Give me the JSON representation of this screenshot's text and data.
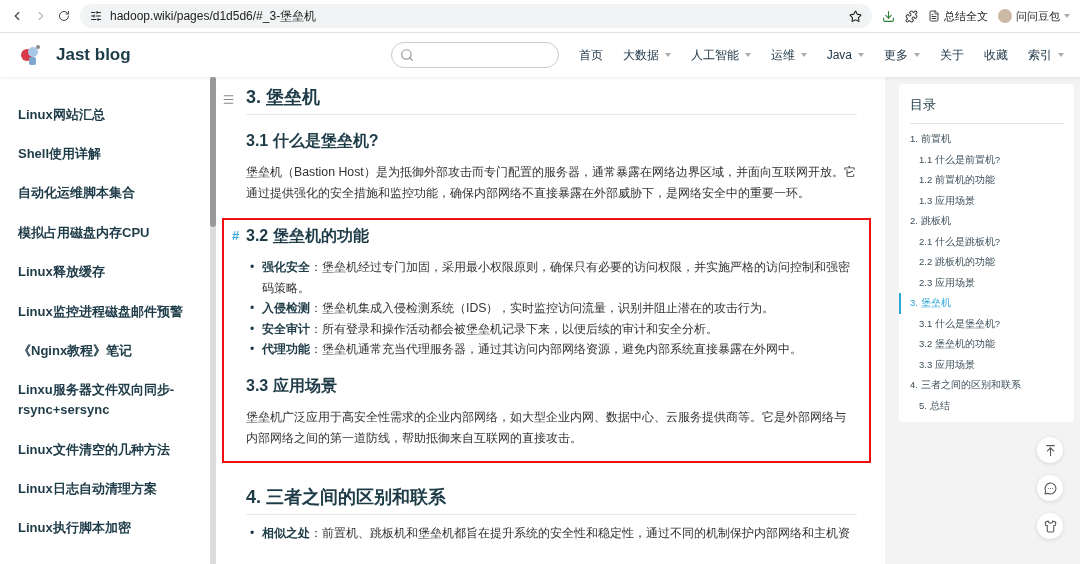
{
  "browser": {
    "url": "hadoop.wiki/pages/d1d5d6/#_3-堡垒机",
    "summary_button": "总结全文",
    "profile_name": "问问豆包"
  },
  "site": {
    "title": "Jast blog",
    "nav": [
      {
        "label": "首页",
        "dropdown": false
      },
      {
        "label": "大数据",
        "dropdown": true
      },
      {
        "label": "人工智能",
        "dropdown": true
      },
      {
        "label": "运维",
        "dropdown": true
      },
      {
        "label": "Java",
        "dropdown": true
      },
      {
        "label": "更多",
        "dropdown": true
      },
      {
        "label": "关于",
        "dropdown": false
      },
      {
        "label": "收藏",
        "dropdown": false
      },
      {
        "label": "索引",
        "dropdown": true
      }
    ]
  },
  "sidebar": {
    "items": [
      "Linux网站汇总",
      "Shell使用详解",
      "自动化运维脚本集合",
      "模拟占用磁盘内存CPU",
      "Linux释放缓存",
      "Linux监控进程磁盘邮件预警",
      "《Nginx教程》笔记",
      "Linxu服务器文件双向同步-rsync+sersync",
      "Linux文件清空的几种方法",
      "Linux日志自动清理方案",
      "Linux执行脚本加密"
    ]
  },
  "article": {
    "blocks": [
      {
        "kind": "h2",
        "text": "3. 堡垒机"
      },
      {
        "kind": "h3",
        "text": "3.1 什么是堡垒机?"
      },
      {
        "kind": "p",
        "text": "堡垒机（Bastion Host）是为抵御外部攻击而专门配置的服务器，通常暴露在网络边界区域，并面向互联网开放。它通过提供强化的安全措施和监控功能，确保内部网络不直接暴露在外部威胁下，是网络安全中的重要一环。"
      },
      {
        "kind": "highlight",
        "children": [
          {
            "kind": "h3",
            "text": "3.2 堡垒机的功能",
            "anchor": "#"
          },
          {
            "kind": "list",
            "marker": "•",
            "items": [
              "**强化安全**：堡垒机经过专门加固，采用最小权限原则，确保只有必要的访问权限，并实施严格的访问控制和强密码策略。",
              "**入侵检测**：堡垒机集成入侵检测系统（IDS），实时监控访问流量，识别并阻止潜在的攻击行为。",
              "**安全审计**：所有登录和操作活动都会被堡垒机记录下来，以便后续的审计和安全分析。",
              "**代理功能**：堡垒机通常充当代理服务器，通过其访问内部网络资源，避免内部系统直接暴露在外网中。"
            ]
          },
          {
            "kind": "h3",
            "text": "3.3 应用场景"
          },
          {
            "kind": "p",
            "text": "堡垒机广泛应用于高安全性需求的企业内部网络，如大型企业内网、数据中心、云服务提供商等。它是外部网络与内部网络之间的第一道防线，帮助抵御来自互联网的直接攻击。"
          }
        ]
      },
      {
        "kind": "h2",
        "text": "4. 三者之间的区别和联系"
      },
      {
        "kind": "list",
        "marker": "•",
        "items": [
          "**相似之处**：前置机、跳板机和堡垒机都旨在提升系统的安全性和稳定性，通过不同的机制保护内部网络和主机资"
        ]
      }
    ]
  },
  "toc": {
    "title": "目录",
    "items": [
      {
        "label": "1. 前置机",
        "selected": false,
        "children": [
          {
            "label": "1.1 什么是前置机?",
            "selected": false
          },
          {
            "label": "1.2 前置机的功能",
            "selected": false
          },
          {
            "label": "1.3 应用场景",
            "selected": false
          }
        ]
      },
      {
        "label": "2. 跳板机",
        "selected": false,
        "children": [
          {
            "label": "2.1 什么是跳板机?",
            "selected": false
          },
          {
            "label": "2.2 跳板机的功能",
            "selected": false
          },
          {
            "label": "2.3 应用场景",
            "selected": false
          }
        ]
      },
      {
        "label": "3. 堡垒机",
        "selected": true,
        "children": [
          {
            "label": "3.1 什么是堡垒机?",
            "selected": false
          },
          {
            "label": "3.2 堡垒机的功能",
            "selected": false
          },
          {
            "label": "3.3 应用场景",
            "selected": false
          }
        ]
      },
      {
        "label": "4. 三者之间的区别和联系",
        "selected": false,
        "children": [
          {
            "label": "5. 总结",
            "selected": false
          }
        ]
      }
    ]
  }
}
